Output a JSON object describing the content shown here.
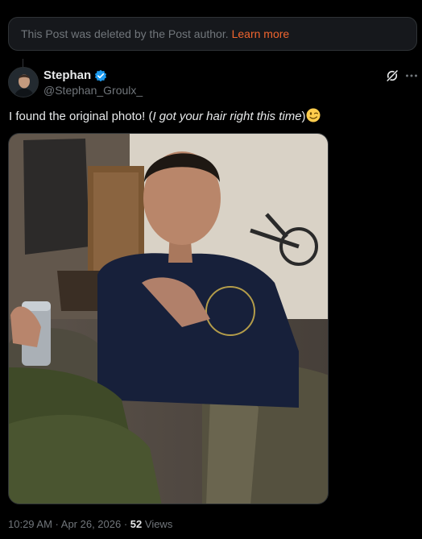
{
  "banner": {
    "text": "This Post was deleted by the Post author.",
    "link": "Learn more"
  },
  "author": {
    "name": "Stephan",
    "handle": "@Stephan_Groulx_"
  },
  "post": {
    "text_start": "I found the original photo! (",
    "text_italic": "I got your hair right this time",
    "text_end": ")"
  },
  "meta": {
    "time": "10:29 AM",
    "separator1": " · ",
    "date": "Apr 26, 2026",
    "separator2": " · ",
    "views_count": "52",
    "views_label": " Views"
  },
  "colors": {
    "background": "#000000",
    "banner_link": "#f0652f",
    "verified_badge": "#1d9bf0",
    "secondary_text": "#71767b"
  },
  "icons": [
    "verified-badge-icon",
    "grok-icon",
    "more-options-icon",
    "winking-face-emoji"
  ]
}
